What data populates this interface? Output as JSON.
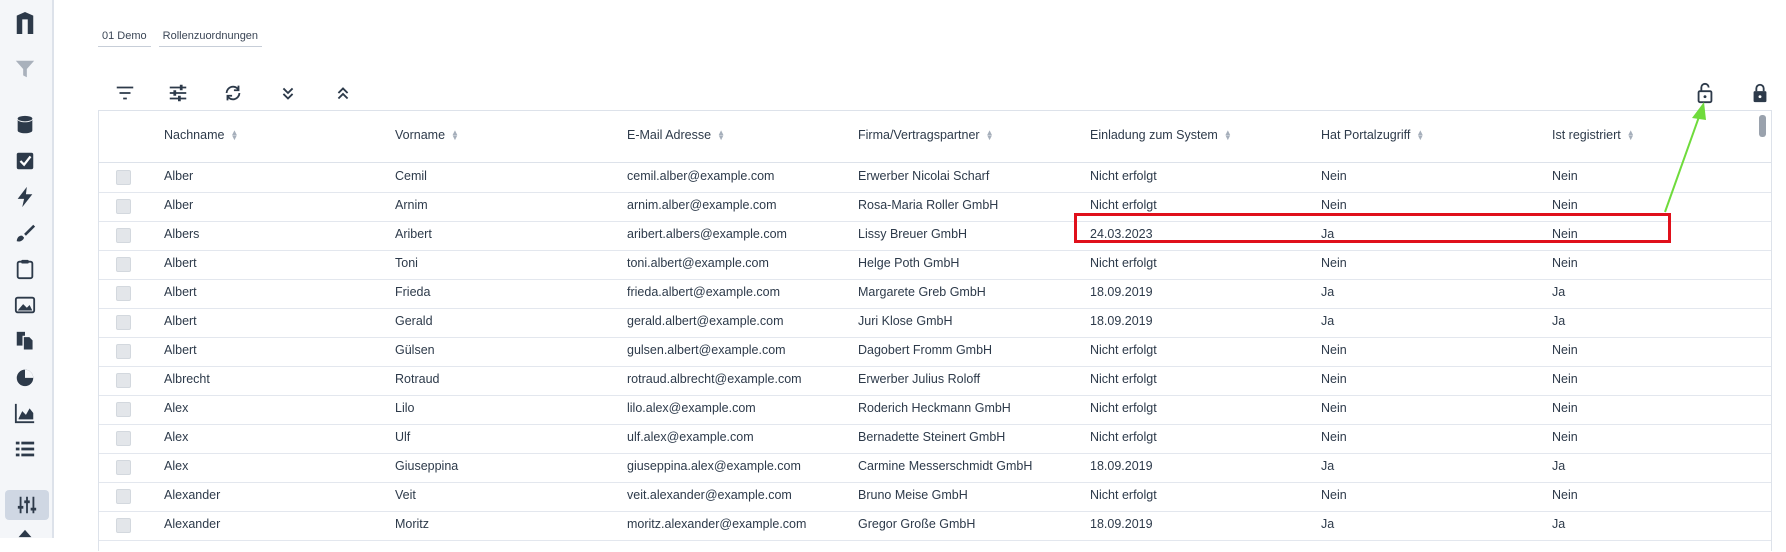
{
  "colors": {
    "accent": "#2d3a4a",
    "highlight": "#e0101b",
    "arrow": "#6fdb3c"
  },
  "sidebar": {
    "icons": [
      "logo-icon",
      "filter-icon",
      "database-icon",
      "checkbox-icon",
      "lightning-icon",
      "brush-icon",
      "clipboard-icon",
      "image-icon",
      "documents-icon",
      "pie-chart-icon",
      "area-chart-icon",
      "list-icon",
      "sliders-icon",
      "arrow-up-icon"
    ]
  },
  "breadcrumb": {
    "items": [
      "01 Demo",
      "Rollenzuordnungen"
    ]
  },
  "toolbar": {
    "icons": [
      "filter-lines-icon",
      "sliders-icon",
      "refresh-icon",
      "expand-all-icon",
      "collapse-all-icon",
      "lock-open-icon",
      "lock-closed-icon"
    ]
  },
  "table": {
    "headers": [
      "Nachname",
      "Vorname",
      "E-Mail Adresse",
      "Firma/Vertragspartner",
      "Einladung zum System",
      "Hat Portalzugriff",
      "Ist registriert"
    ],
    "rows": [
      [
        "Alber",
        "Cemil",
        "cemil.alber@example.com",
        "Erwerber Nicolai Scharf",
        "Nicht erfolgt",
        "Nein",
        "Nein"
      ],
      [
        "Alber",
        "Arnim",
        "arnim.alber@example.com",
        "Rosa-Maria Roller GmbH",
        "Nicht erfolgt",
        "Nein",
        "Nein"
      ],
      [
        "Albers",
        "Aribert",
        "aribert.albers@example.com",
        "Lissy Breuer GmbH",
        "24.03.2023",
        "Ja",
        "Nein"
      ],
      [
        "Albert",
        "Toni",
        "toni.albert@example.com",
        "Helge Poth GmbH",
        "Nicht erfolgt",
        "Nein",
        "Nein"
      ],
      [
        "Albert",
        "Frieda",
        "frieda.albert@example.com",
        "Margarete Greb GmbH",
        "18.09.2019",
        "Ja",
        "Ja"
      ],
      [
        "Albert",
        "Gerald",
        "gerald.albert@example.com",
        "Juri Klose GmbH",
        "18.09.2019",
        "Ja",
        "Ja"
      ],
      [
        "Albert",
        "Gülsen",
        "gulsen.albert@example.com",
        "Dagobert Fromm GmbH",
        "Nicht erfolgt",
        "Nein",
        "Nein"
      ],
      [
        "Albrecht",
        "Rotraud",
        "rotraud.albrecht@example.com",
        "Erwerber Julius Roloff",
        "Nicht erfolgt",
        "Nein",
        "Nein"
      ],
      [
        "Alex",
        "Lilo",
        "lilo.alex@example.com",
        "Roderich Heckmann GmbH",
        "Nicht erfolgt",
        "Nein",
        "Nein"
      ],
      [
        "Alex",
        "Ulf",
        "ulf.alex@example.com",
        "Bernadette Steinert GmbH",
        "Nicht erfolgt",
        "Nein",
        "Nein"
      ],
      [
        "Alex",
        "Giuseppina",
        "giuseppina.alex@example.com",
        "Carmine Messerschmidt GmbH",
        "18.09.2019",
        "Ja",
        "Ja"
      ],
      [
        "Alexander",
        "Veit",
        "veit.alexander@example.com",
        "Bruno Meise GmbH",
        "Nicht erfolgt",
        "Nein",
        "Nein"
      ],
      [
        "Alexander",
        "Moritz",
        "moritz.alexander@example.com",
        "Gregor Große GmbH",
        "18.09.2019",
        "Ja",
        "Ja"
      ]
    ]
  }
}
